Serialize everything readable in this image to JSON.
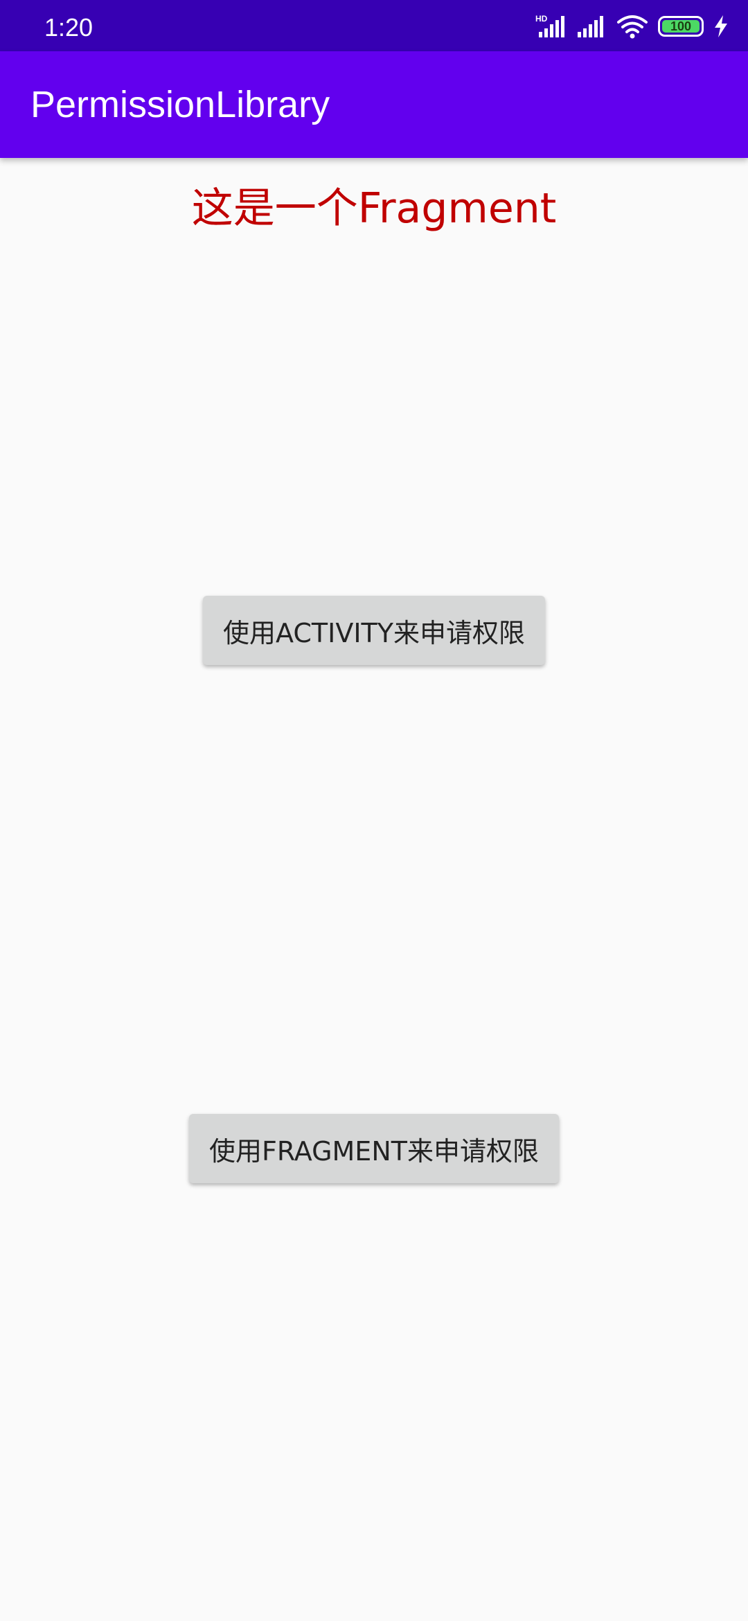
{
  "status_bar": {
    "time": "1:20",
    "network_badge": "HD",
    "battery_level": "100",
    "icons": [
      "hd-signal-icon",
      "signal-icon",
      "wifi-icon",
      "battery-icon",
      "charging-icon"
    ]
  },
  "app_bar": {
    "title": "PermissionLibrary"
  },
  "content": {
    "fragment_label": "这是一个Fragment",
    "activity_button_label": "使用ACTIVITY来申请权限",
    "fragment_button_label": "使用FRAGMENT来申请权限"
  },
  "colors": {
    "status_bar": "#3700b3",
    "app_bar": "#6200ee",
    "background": "#fafafa",
    "label_red": "#c00000",
    "button_bg": "#d6d7d7"
  }
}
